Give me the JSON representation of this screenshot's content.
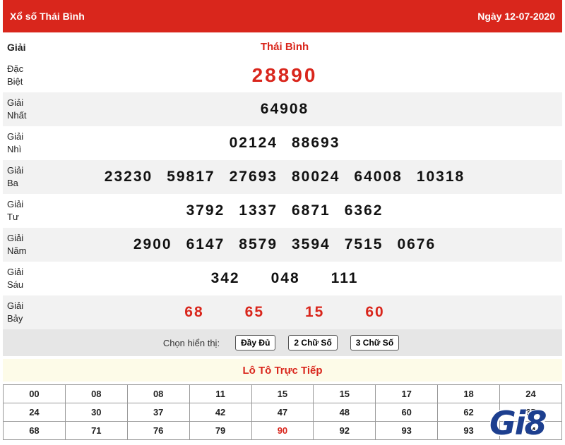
{
  "header": {
    "title": "Xổ số Thái Bình",
    "date": "Ngày 12-07-2020"
  },
  "results": {
    "head_label": "Giải",
    "province": "Thái Bình",
    "prizes": [
      {
        "label": [
          "Đặc",
          "Biệt"
        ],
        "numbers": [
          "28890"
        ]
      },
      {
        "label": [
          "Giải",
          "Nhất"
        ],
        "numbers": [
          "64908"
        ]
      },
      {
        "label": [
          "Giải",
          "Nhì"
        ],
        "numbers": [
          "02124",
          "88693"
        ]
      },
      {
        "label": [
          "Giải",
          "Ba"
        ],
        "numbers": [
          "23230",
          "59817",
          "27693",
          "80024",
          "64008",
          "10318"
        ]
      },
      {
        "label": [
          "Giải",
          "Tư"
        ],
        "numbers": [
          "3792",
          "1337",
          "6871",
          "6362"
        ]
      },
      {
        "label": [
          "Giải",
          "Năm"
        ],
        "numbers": [
          "2900",
          "6147",
          "8579",
          "3594",
          "7515",
          "0676"
        ]
      },
      {
        "label": [
          "Giải",
          "Sáu"
        ],
        "numbers": [
          "342",
          "048",
          "111"
        ]
      },
      {
        "label": [
          "Giải",
          "Bảy"
        ],
        "numbers": [
          "68",
          "65",
          "15",
          "60"
        ]
      }
    ]
  },
  "display_options": {
    "label": "Chọn hiển thị:",
    "full": "Đầy Đủ",
    "two_digit": "2 Chữ Số",
    "three_digit": "3 Chữ Số"
  },
  "loto": {
    "title": "Lô Tô Trực Tiếp",
    "rows": [
      [
        "00",
        "08",
        "08",
        "11",
        "15",
        "15",
        "17",
        "18",
        "24"
      ],
      [
        "24",
        "30",
        "37",
        "42",
        "47",
        "48",
        "60",
        "62",
        "65"
      ],
      [
        "68",
        "71",
        "76",
        "79",
        "90",
        "92",
        "93",
        "93",
        "94"
      ]
    ],
    "highlighted": "90"
  },
  "watermark": "Gi8",
  "colors": {
    "accent": "#d9261c",
    "alt_row": "#f2f2f2",
    "watermark": "#1d3f8f"
  }
}
